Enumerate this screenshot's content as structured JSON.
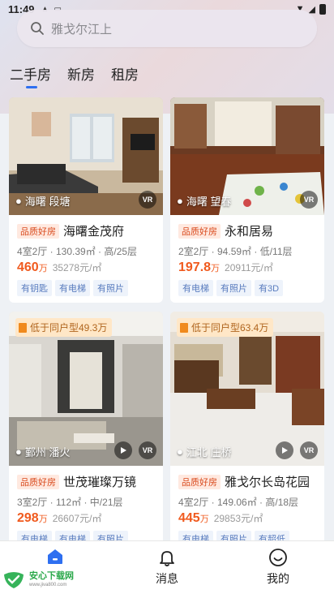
{
  "status_bar": {
    "time": "11:49"
  },
  "search": {
    "placeholder": "雅戈尔江上"
  },
  "tabs": [
    {
      "label": "二手房",
      "active": true
    },
    {
      "label": "新房",
      "active": false
    },
    {
      "label": "租房",
      "active": false
    }
  ],
  "listings": [
    {
      "location": "海曙 段塘",
      "badge": "品质好房",
      "title": "海曙金茂府",
      "meta": "4室2厅 · 130.39㎡ · 高/25层",
      "price": "460",
      "price_unit": "万",
      "unit_price": "35278元/㎡",
      "tags": [
        "有钥匙",
        "有电梯",
        "有照片"
      ],
      "has_vr": true
    },
    {
      "location": "海曙 望春",
      "badge": "品质好房",
      "title": "永和居易",
      "meta": "2室2厅 · 94.59㎡ · 低/11层",
      "price": "197.8",
      "price_unit": "万",
      "unit_price": "20911元/㎡",
      "tags": [
        "有电梯",
        "有照片",
        "有3D"
      ],
      "has_vr": true
    },
    {
      "promo": "低于同户型49.3万",
      "location": "鄞州 潘火",
      "badge": "品质好房",
      "title": "世茂璀璨万镜",
      "meta": "3室2厅 · 112㎡ · 中/21层",
      "price": "298",
      "price_unit": "万",
      "unit_price": "26607元/㎡",
      "tags": [
        "有电梯",
        "有电梯",
        "有照片"
      ],
      "has_vr": true
    },
    {
      "promo": "低于同户型63.4万",
      "location": "江北 庄桥",
      "badge": "品质好房",
      "title": "雅戈尔长岛花园",
      "meta": "4室2厅 · 149.06㎡ · 高/18层",
      "price": "445",
      "price_unit": "万",
      "unit_price": "29853元/㎡",
      "tags": [
        "有电梯",
        "有照片",
        "有超低"
      ],
      "has_vr": true
    }
  ],
  "bottom_nav": {
    "items": [
      {
        "label": "",
        "icon": "home-icon",
        "active": true
      },
      {
        "label": "消息",
        "icon": "bell-icon"
      },
      {
        "label": "我的",
        "icon": "smile-icon"
      }
    ]
  },
  "watermark": {
    "main": "安心下载网",
    "sub": "www.jiva800.com"
  },
  "colors": {
    "accent": "#2e6ff0",
    "price": "#f05a1e",
    "badge_bg": "#ffe9e0",
    "badge_fg": "#d94b1e"
  }
}
